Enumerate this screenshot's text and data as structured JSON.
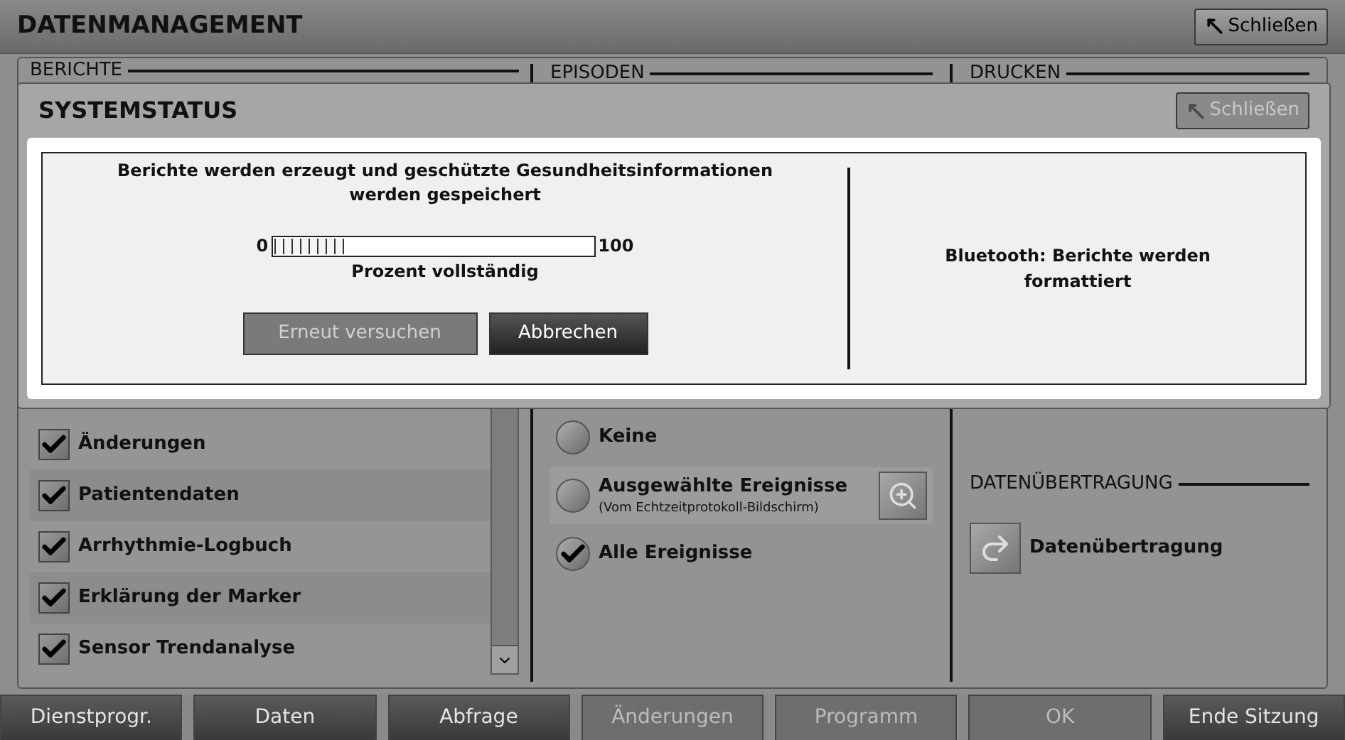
{
  "window": {
    "title": "DATENMANAGEMENT",
    "close_button": "Schließen"
  },
  "reports": {
    "title": "BERICHTE",
    "items": [
      {
        "label": "Änderungen",
        "checked": true
      },
      {
        "label": "Patientendaten",
        "checked": true
      },
      {
        "label": "Arrhythmie-Logbuch",
        "checked": true
      },
      {
        "label": "Erklärung der Marker",
        "checked": true
      },
      {
        "label": "Sensor Trendanalyse",
        "checked": true
      }
    ]
  },
  "episodes": {
    "title": "EPISODEN",
    "options": [
      {
        "label": "Keine",
        "selected": false
      },
      {
        "label": "Ausgewählte Ereignisse",
        "note": "(Vom Echtzeitprotokoll-Bildschirm)",
        "selected": false
      },
      {
        "label": "Alle Ereignisse",
        "selected": true
      }
    ]
  },
  "print": {
    "title": "DRUCKEN"
  },
  "transfer": {
    "title": "DATENÜBERTRAGUNG",
    "button": "Datenübertragung"
  },
  "dialog": {
    "title": "SYSTEMSTATUS",
    "close_button": "Schließen",
    "message": "Berichte werden erzeugt und geschützte Gesundheitsinformationen werden gespeichert",
    "progress": {
      "min": "0",
      "max": "100",
      "level": 0.22,
      "caption": "Prozent vollständig"
    },
    "buttons": [
      {
        "label": "Erneut versuchen",
        "disabled": true
      },
      {
        "label": "Abbrechen",
        "disabled": false
      }
    ],
    "status": "Bluetooth: Berichte werden formattiert"
  },
  "nav": [
    {
      "label": "Dienstprogr.",
      "disabled": false
    },
    {
      "label": "Daten",
      "disabled": false
    },
    {
      "label": "Abfrage",
      "disabled": false
    },
    {
      "label": "Änderungen",
      "disabled": true
    },
    {
      "label": "Programm",
      "disabled": true
    },
    {
      "label": "OK",
      "disabled": true
    },
    {
      "label": "Ende Sitzung",
      "disabled": false
    }
  ]
}
